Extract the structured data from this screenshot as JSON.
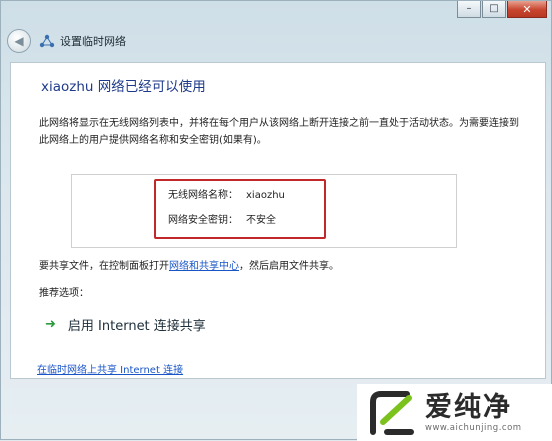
{
  "window": {
    "title": "设置临时网络",
    "controls": {
      "minimize": "–",
      "maximize": "□",
      "close": "✕"
    }
  },
  "content": {
    "heading": "xiaozhu 网络已经可以使用",
    "description": "此网络将显示在无线网络列表中，并将在每个用户从该网络上断开连接之前一直处于活动状态。为需要连接到此网络上的用户提供网络名称和安全密钥(如果有)。",
    "network_name_label": "无线网络名称：",
    "network_name_value": "xiaozhu",
    "security_key_label": "网络安全密钥：",
    "security_key_value": "不安全",
    "share_prefix": "要共享文件，在控制面板打开",
    "share_link": "网络和共享中心",
    "share_suffix": "，然后启用文件共享。",
    "recommended_label": "推荐选项：",
    "option_label": "启用 Internet 连接共享",
    "bottom_link": "在临时网络上共享 Internet 连接"
  },
  "watermark": {
    "brand": "爱纯净",
    "url": "www.aichunjing.com"
  },
  "colors": {
    "heading": "#1e3a8a",
    "link": "#1a55c8",
    "highlight": "#c0282a",
    "arrow": "#2a9a3a",
    "logo_green": "#7cc21d"
  }
}
